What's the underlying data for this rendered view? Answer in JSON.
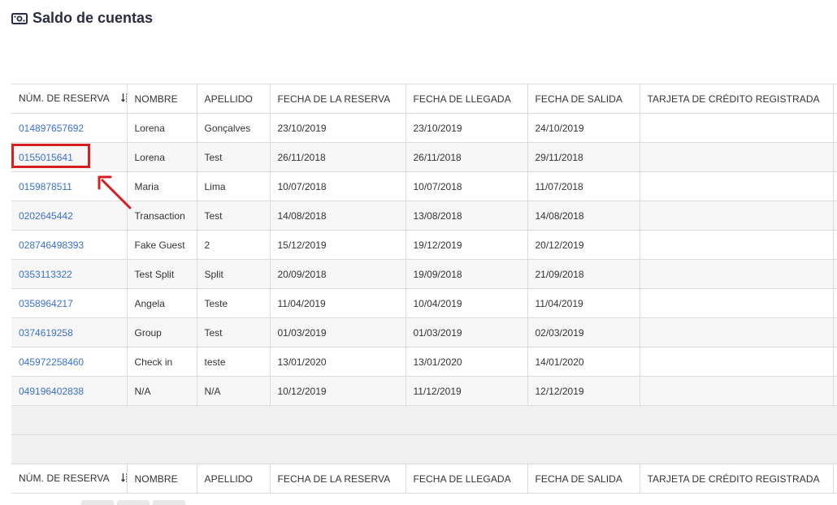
{
  "page": {
    "title": "Saldo de cuentas",
    "title_icon": "money-bill-icon"
  },
  "table": {
    "headers": [
      "NÚM. DE RESERVA",
      "NOMBRE",
      "APELLIDO",
      "FECHA DE LA RESERVA",
      "FECHA DE LLEGADA",
      "FECHA DE SALIDA",
      "TARJETA DE CRÉDITO REGISTRADA"
    ],
    "sort_icon": "sort-descending-icon",
    "rows": [
      [
        "014897657692",
        "Lorena",
        "Gonçalves",
        "23/10/2019",
        "23/10/2019",
        "24/10/2019",
        ""
      ],
      [
        "0155015641",
        "Lorena",
        "Test",
        "26/11/2018",
        "26/11/2018",
        "29/11/2018",
        ""
      ],
      [
        "0159878511",
        "Maria",
        "Lima",
        "10/07/2018",
        "10/07/2018",
        "11/07/2018",
        ""
      ],
      [
        "0202645442",
        "Transaction",
        "Test",
        "14/08/2018",
        "13/08/2018",
        "14/08/2018",
        ""
      ],
      [
        "028746498393",
        "Fake Guest",
        "2",
        "15/12/2019",
        "19/12/2019",
        "20/12/2019",
        ""
      ],
      [
        "0353113322",
        "Test Split",
        "Split",
        "20/09/2018",
        "19/09/2018",
        "21/09/2018",
        ""
      ],
      [
        "0358964217",
        "Angela",
        "Teste",
        "11/04/2019",
        "10/04/2019",
        "11/04/2019",
        ""
      ],
      [
        "0374619258",
        "Group",
        "Test",
        "01/03/2019",
        "01/03/2019",
        "02/03/2019",
        ""
      ],
      [
        "045972258460",
        "Check in",
        "teste",
        "13/01/2020",
        "13/01/2020",
        "14/01/2020",
        ""
      ],
      [
        "049196402838",
        "N/A",
        "N/A",
        "10/12/2019",
        "11/12/2019",
        "12/12/2019",
        ""
      ]
    ]
  },
  "annotation": {
    "highlight_color": "#d62020",
    "arrow_icon": "red-arrow-icon"
  },
  "colors": {
    "link": "#3a6fd8",
    "border": "#dcdcdc",
    "title": "#2b2d42"
  }
}
